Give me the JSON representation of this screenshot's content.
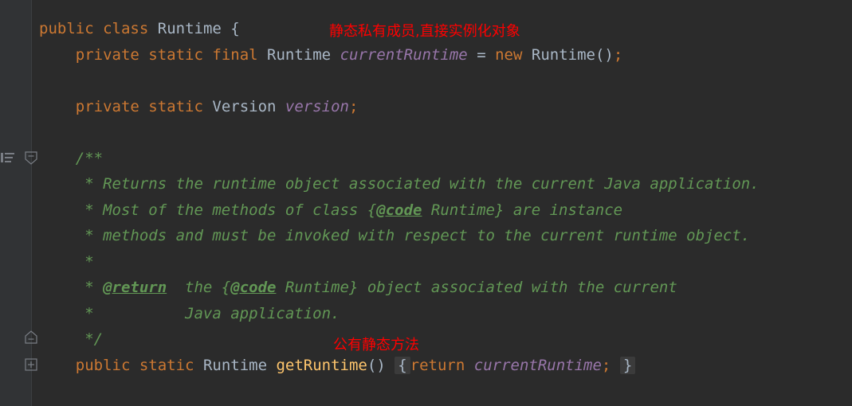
{
  "editor": {
    "line1": {
      "kw1": "public",
      "kw2": "class",
      "name": "Runtime",
      "brace": "{"
    },
    "line2": {
      "kw1": "private",
      "kw2": "static",
      "kw3": "final",
      "type": "Runtime",
      "field": "currentRuntime",
      "eq": "=",
      "kw4": "new",
      "ctor": "Runtime()",
      "semi": ";"
    },
    "line3": {
      "kw1": "private",
      "kw2": "static",
      "type": "Version",
      "field": "version",
      "semi": ";"
    },
    "doc": {
      "open": "/**",
      "l1": " * Returns the runtime object associated with the current Java application.",
      "l2a": " * Most of the methods of class {",
      "l2tag": "@code",
      "l2b": " Runtime} are instance",
      "l3": " * methods and must be invoked with respect to the current runtime object.",
      "l4": " *",
      "l5a": " * ",
      "l5tag": "@return",
      "l5b": "  the {",
      "l5tag2": "@code",
      "l5c": " Runtime} object associated with the current",
      "l6": " *          Java application.",
      "close": " */"
    },
    "method": {
      "kw1": "public",
      "kw2": "static",
      "type": "Runtime",
      "name": "getRuntime",
      "parens": "()",
      "open": "{",
      "kw3": "return",
      "field": "currentRuntime",
      "semi": ";",
      "close": "}"
    }
  },
  "annotations": {
    "a1": "静态私有成员,直接实例化对象",
    "a2": "公有静态方法"
  },
  "colors": {
    "background": "#2b2b2b",
    "keyword": "#cc7832",
    "identifier": "#a9b7c6",
    "field": "#9876aa",
    "method": "#ffc66d",
    "doc": "#629755",
    "annotation": "#ff0000"
  },
  "icons": [
    "structure-icon",
    "fold-icon",
    "unfold-icon",
    "expand-icon"
  ]
}
